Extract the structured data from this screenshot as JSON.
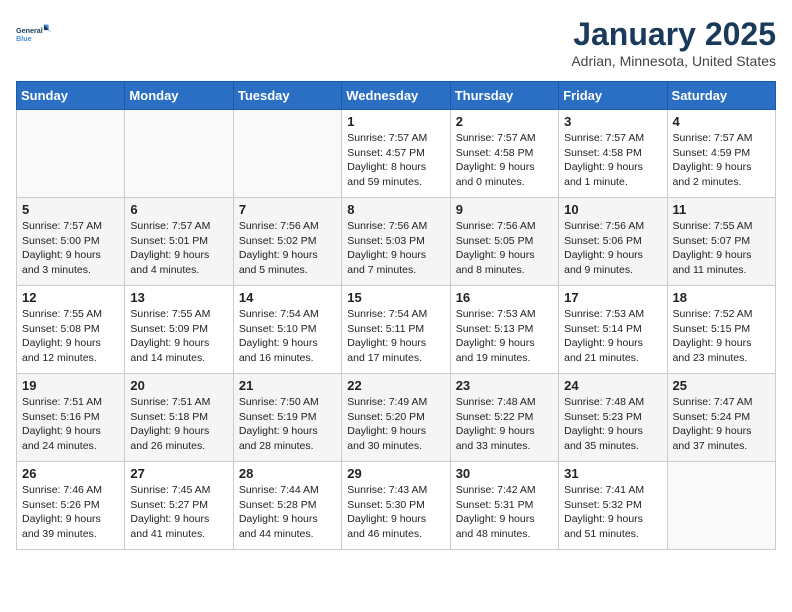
{
  "header": {
    "logo_line1": "General",
    "logo_line2": "Blue",
    "title": "January 2025",
    "location": "Adrian, Minnesota, United States"
  },
  "days_of_week": [
    "Sunday",
    "Monday",
    "Tuesday",
    "Wednesday",
    "Thursday",
    "Friday",
    "Saturday"
  ],
  "weeks": [
    [
      {
        "day": "",
        "info": ""
      },
      {
        "day": "",
        "info": ""
      },
      {
        "day": "",
        "info": ""
      },
      {
        "day": "1",
        "info": "Sunrise: 7:57 AM\nSunset: 4:57 PM\nDaylight: 8 hours\nand 59 minutes."
      },
      {
        "day": "2",
        "info": "Sunrise: 7:57 AM\nSunset: 4:58 PM\nDaylight: 9 hours\nand 0 minutes."
      },
      {
        "day": "3",
        "info": "Sunrise: 7:57 AM\nSunset: 4:58 PM\nDaylight: 9 hours\nand 1 minute."
      },
      {
        "day": "4",
        "info": "Sunrise: 7:57 AM\nSunset: 4:59 PM\nDaylight: 9 hours\nand 2 minutes."
      }
    ],
    [
      {
        "day": "5",
        "info": "Sunrise: 7:57 AM\nSunset: 5:00 PM\nDaylight: 9 hours\nand 3 minutes."
      },
      {
        "day": "6",
        "info": "Sunrise: 7:57 AM\nSunset: 5:01 PM\nDaylight: 9 hours\nand 4 minutes."
      },
      {
        "day": "7",
        "info": "Sunrise: 7:56 AM\nSunset: 5:02 PM\nDaylight: 9 hours\nand 5 minutes."
      },
      {
        "day": "8",
        "info": "Sunrise: 7:56 AM\nSunset: 5:03 PM\nDaylight: 9 hours\nand 7 minutes."
      },
      {
        "day": "9",
        "info": "Sunrise: 7:56 AM\nSunset: 5:05 PM\nDaylight: 9 hours\nand 8 minutes."
      },
      {
        "day": "10",
        "info": "Sunrise: 7:56 AM\nSunset: 5:06 PM\nDaylight: 9 hours\nand 9 minutes."
      },
      {
        "day": "11",
        "info": "Sunrise: 7:55 AM\nSunset: 5:07 PM\nDaylight: 9 hours\nand 11 minutes."
      }
    ],
    [
      {
        "day": "12",
        "info": "Sunrise: 7:55 AM\nSunset: 5:08 PM\nDaylight: 9 hours\nand 12 minutes."
      },
      {
        "day": "13",
        "info": "Sunrise: 7:55 AM\nSunset: 5:09 PM\nDaylight: 9 hours\nand 14 minutes."
      },
      {
        "day": "14",
        "info": "Sunrise: 7:54 AM\nSunset: 5:10 PM\nDaylight: 9 hours\nand 16 minutes."
      },
      {
        "day": "15",
        "info": "Sunrise: 7:54 AM\nSunset: 5:11 PM\nDaylight: 9 hours\nand 17 minutes."
      },
      {
        "day": "16",
        "info": "Sunrise: 7:53 AM\nSunset: 5:13 PM\nDaylight: 9 hours\nand 19 minutes."
      },
      {
        "day": "17",
        "info": "Sunrise: 7:53 AM\nSunset: 5:14 PM\nDaylight: 9 hours\nand 21 minutes."
      },
      {
        "day": "18",
        "info": "Sunrise: 7:52 AM\nSunset: 5:15 PM\nDaylight: 9 hours\nand 23 minutes."
      }
    ],
    [
      {
        "day": "19",
        "info": "Sunrise: 7:51 AM\nSunset: 5:16 PM\nDaylight: 9 hours\nand 24 minutes."
      },
      {
        "day": "20",
        "info": "Sunrise: 7:51 AM\nSunset: 5:18 PM\nDaylight: 9 hours\nand 26 minutes."
      },
      {
        "day": "21",
        "info": "Sunrise: 7:50 AM\nSunset: 5:19 PM\nDaylight: 9 hours\nand 28 minutes."
      },
      {
        "day": "22",
        "info": "Sunrise: 7:49 AM\nSunset: 5:20 PM\nDaylight: 9 hours\nand 30 minutes."
      },
      {
        "day": "23",
        "info": "Sunrise: 7:48 AM\nSunset: 5:22 PM\nDaylight: 9 hours\nand 33 minutes."
      },
      {
        "day": "24",
        "info": "Sunrise: 7:48 AM\nSunset: 5:23 PM\nDaylight: 9 hours\nand 35 minutes."
      },
      {
        "day": "25",
        "info": "Sunrise: 7:47 AM\nSunset: 5:24 PM\nDaylight: 9 hours\nand 37 minutes."
      }
    ],
    [
      {
        "day": "26",
        "info": "Sunrise: 7:46 AM\nSunset: 5:26 PM\nDaylight: 9 hours\nand 39 minutes."
      },
      {
        "day": "27",
        "info": "Sunrise: 7:45 AM\nSunset: 5:27 PM\nDaylight: 9 hours\nand 41 minutes."
      },
      {
        "day": "28",
        "info": "Sunrise: 7:44 AM\nSunset: 5:28 PM\nDaylight: 9 hours\nand 44 minutes."
      },
      {
        "day": "29",
        "info": "Sunrise: 7:43 AM\nSunset: 5:30 PM\nDaylight: 9 hours\nand 46 minutes."
      },
      {
        "day": "30",
        "info": "Sunrise: 7:42 AM\nSunset: 5:31 PM\nDaylight: 9 hours\nand 48 minutes."
      },
      {
        "day": "31",
        "info": "Sunrise: 7:41 AM\nSunset: 5:32 PM\nDaylight: 9 hours\nand 51 minutes."
      },
      {
        "day": "",
        "info": ""
      }
    ]
  ]
}
